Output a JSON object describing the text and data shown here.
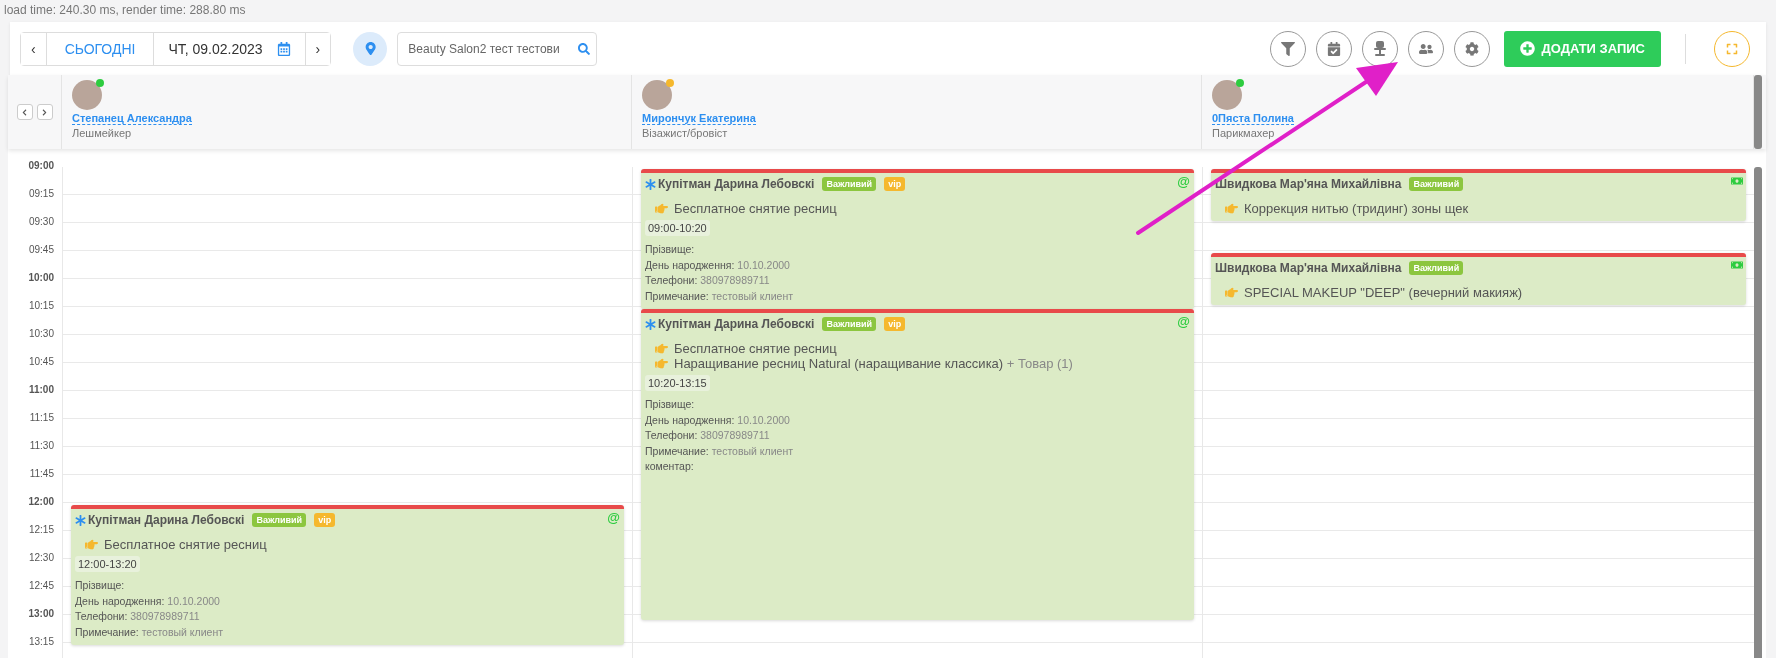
{
  "perf": "load time: 240.30 ms, render time: 288.80 ms",
  "toolbar": {
    "prev": "‹",
    "today": "СЬОГОДНІ",
    "date": "ЧТ, 09.02.2023",
    "next": "›",
    "search": {
      "value": "Beauty Salon2 тест тестови"
    },
    "add_button": "ДОДАТИ ЗАПИС"
  },
  "staff": [
    {
      "name": "Степанец Александра",
      "role": "Лешмейкер",
      "color": "#2ecc40"
    },
    {
      "name": "Мирончук Екатерина",
      "role": "Візажист/бровіст",
      "color": "#f5b82e"
    },
    {
      "name": "0Пяста Полина",
      "role": "Парикмахер",
      "color": "#2ecc40"
    }
  ],
  "times": [
    {
      "label": "09:00",
      "kind": "hour"
    },
    {
      "label": "09:15",
      "kind": "quarter"
    },
    {
      "label": "09:30",
      "kind": "quarter"
    },
    {
      "label": "09:45",
      "kind": "quarter"
    },
    {
      "label": "10:00",
      "kind": "hour"
    },
    {
      "label": "10:15",
      "kind": "quarter"
    },
    {
      "label": "10:30",
      "kind": "quarter"
    },
    {
      "label": "10:45",
      "kind": "quarter"
    },
    {
      "label": "11:00",
      "kind": "hour"
    },
    {
      "label": "11:15",
      "kind": "quarter"
    },
    {
      "label": "11:30",
      "kind": "quarter"
    },
    {
      "label": "11:45",
      "kind": "quarter"
    },
    {
      "label": "12:00",
      "kind": "hour"
    },
    {
      "label": "12:15",
      "kind": "quarter"
    },
    {
      "label": "12:30",
      "kind": "quarter"
    },
    {
      "label": "12:45",
      "kind": "quarter"
    },
    {
      "label": "13:00",
      "kind": "hour"
    },
    {
      "label": "13:15",
      "kind": "quarter"
    }
  ],
  "columns": [
    {
      "appointments": [
        {
          "client": "Купітман Дарина Лебовскі",
          "kind": "online",
          "badge": "@",
          "tags": [
            {
              "label": "Важливий",
              "color": "#8cc63f"
            },
            {
              "label": "vip",
              "color": "#f5b82e"
            }
          ],
          "services": [
            {
              "name": "Бесплатное снятие ресниц"
            }
          ],
          "time": "12:00-13:20",
          "details": [
            {
              "label": "Прізвище:"
            },
            {
              "label": "День народження:",
              "value": "10.10.2000"
            },
            {
              "label": "Телефони:",
              "value": "380978989711"
            },
            {
              "label": "Примечание:",
              "value": "тестовый клиент"
            }
          ]
        }
      ]
    },
    {
      "appointments": [
        {
          "client": "Купітман Дарина Лебовскі",
          "kind": "online",
          "badge": "@",
          "tags": [
            {
              "label": "Важливий",
              "color": "#8cc63f"
            },
            {
              "label": "vip",
              "color": "#f5b82e"
            }
          ],
          "services": [
            {
              "name": "Бесплатное снятие ресниц"
            }
          ],
          "time": "09:00-10:20",
          "details": [
            {
              "label": "Прізвище:"
            },
            {
              "label": "День народження:",
              "value": "10.10.2000"
            },
            {
              "label": "Телефони:",
              "value": "380978989711"
            },
            {
              "label": "Примечание:",
              "value": "тестовый клиент"
            }
          ]
        },
        {
          "client": "Купітман Дарина Лебовскі",
          "kind": "online",
          "badge": "@",
          "tags": [
            {
              "label": "Важливий",
              "color": "#8cc63f"
            },
            {
              "label": "vip",
              "color": "#f5b82e"
            }
          ],
          "services": [
            {
              "name": "Бесплатное снятие ресниц"
            },
            {
              "name": "Наращивание ресниц Natural (наращивание классика)",
              "extra": "+ Товар (1)"
            }
          ],
          "time": "10:20-13:15",
          "details": [
            {
              "label": "Прізвище:"
            },
            {
              "label": "День народження:",
              "value": "10.10.2000"
            },
            {
              "label": "Телефони:",
              "value": "380978989711"
            },
            {
              "label": "Примечание:",
              "value": "тестовый клиент"
            },
            {
              "label": "коментар:"
            }
          ]
        }
      ]
    },
    {
      "appointments": [
        {
          "client": "Швидкова Мар'яна Михайлівна",
          "kind": "cash",
          "tags": [
            {
              "label": "Важливий",
              "color": "#8cc63f"
            }
          ],
          "services": [
            {
              "name": "Коррекция нитью (тридинг) зоны щек"
            }
          ]
        },
        {
          "client": "Швидкова Мар'яна Михайлівна",
          "kind": "cash",
          "tags": [
            {
              "label": "Важливий",
              "color": "#8cc63f"
            }
          ],
          "services": [
            {
              "name": "SPECIAL MAKEUP \"DEEP\" (вечерний макияж)"
            }
          ]
        }
      ]
    }
  ]
}
